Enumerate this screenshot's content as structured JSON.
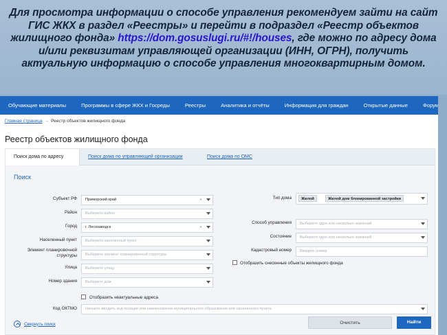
{
  "banner": {
    "part1": "Для просмотра информации о способе управления  рекомендуем зайти на сайт ГИС ЖКХ в раздел «Реестры» и перейти в подраздел «Реестр объектов жилищного фонда» ",
    "link": "https://dom.gosuslugi.ru/#!/houses",
    "part2": ", где можно по адресу дома и/или реквизитам управляющей организации (ИНН, ОГРН), получить актуальную информацию о способе управления многоквартирным домом."
  },
  "nav": {
    "items": [
      "Обучающие материалы",
      "Программы в сфере ЖКХ и Госреды",
      "Реестры",
      "Аналитика и отчёты",
      "Информация для граждан",
      "Открытые данные",
      "Форум"
    ]
  },
  "breadcrumb": {
    "home": "Главная страница",
    "sep": "→",
    "current": "Реестр объектов жилищного фонда"
  },
  "page_title": "Реестр объектов жилищного фонда",
  "tabs": [
    "Поиск дома по адресу",
    "Поиск дома по управляющей организации",
    "Поиск дома по ОМС"
  ],
  "search": {
    "section_title": "Поиск",
    "left": [
      {
        "label": "Субъект РФ",
        "value": "Приморский край",
        "placeholder": ""
      },
      {
        "label": "Район",
        "value": "",
        "placeholder": "Выберите район"
      },
      {
        "label": "Город",
        "value": "г. Лесозаводск",
        "placeholder": ""
      },
      {
        "label": "Населенный пункт",
        "value": "",
        "placeholder": "Выберите населенный пункт"
      },
      {
        "label": "Элемент планировочной структуры",
        "value": "",
        "placeholder": "Выберите элемент планировочной структуры"
      },
      {
        "label": "Улица",
        "value": "",
        "placeholder": "Выберите улицу"
      },
      {
        "label": "Номер здания",
        "value": "",
        "placeholder": "Выберите дом"
      }
    ],
    "house_type": {
      "label": "Тип дома",
      "chips": [
        "Жилой",
        "Жилой дом блокированной застройки"
      ]
    },
    "management": {
      "label": "Способ управления",
      "placeholder": "Выберите одно или несколько значений"
    },
    "status": {
      "label": "Состояние",
      "placeholder": "Выберите одно или несколько значений"
    },
    "cadastral": {
      "label": "Кадастровый номер",
      "placeholder": "Введите номер"
    },
    "demolished_label": "Отобразить снесенные объекты жилищного фонда",
    "inactive_label": "Отобразить неактуальные адреса",
    "oktmo": {
      "label": "Код ОКТМО",
      "placeholder": "Начните вводить код позиции или наименование муниципального образования или населенного пункта"
    },
    "collapse_label": "Свернуть поиск",
    "clear_button": "Очистить",
    "find_button": "Найти"
  },
  "colors": {
    "nav": "#1d67c0",
    "link": "#1d62b8",
    "banner_link": "#2a16c8"
  }
}
